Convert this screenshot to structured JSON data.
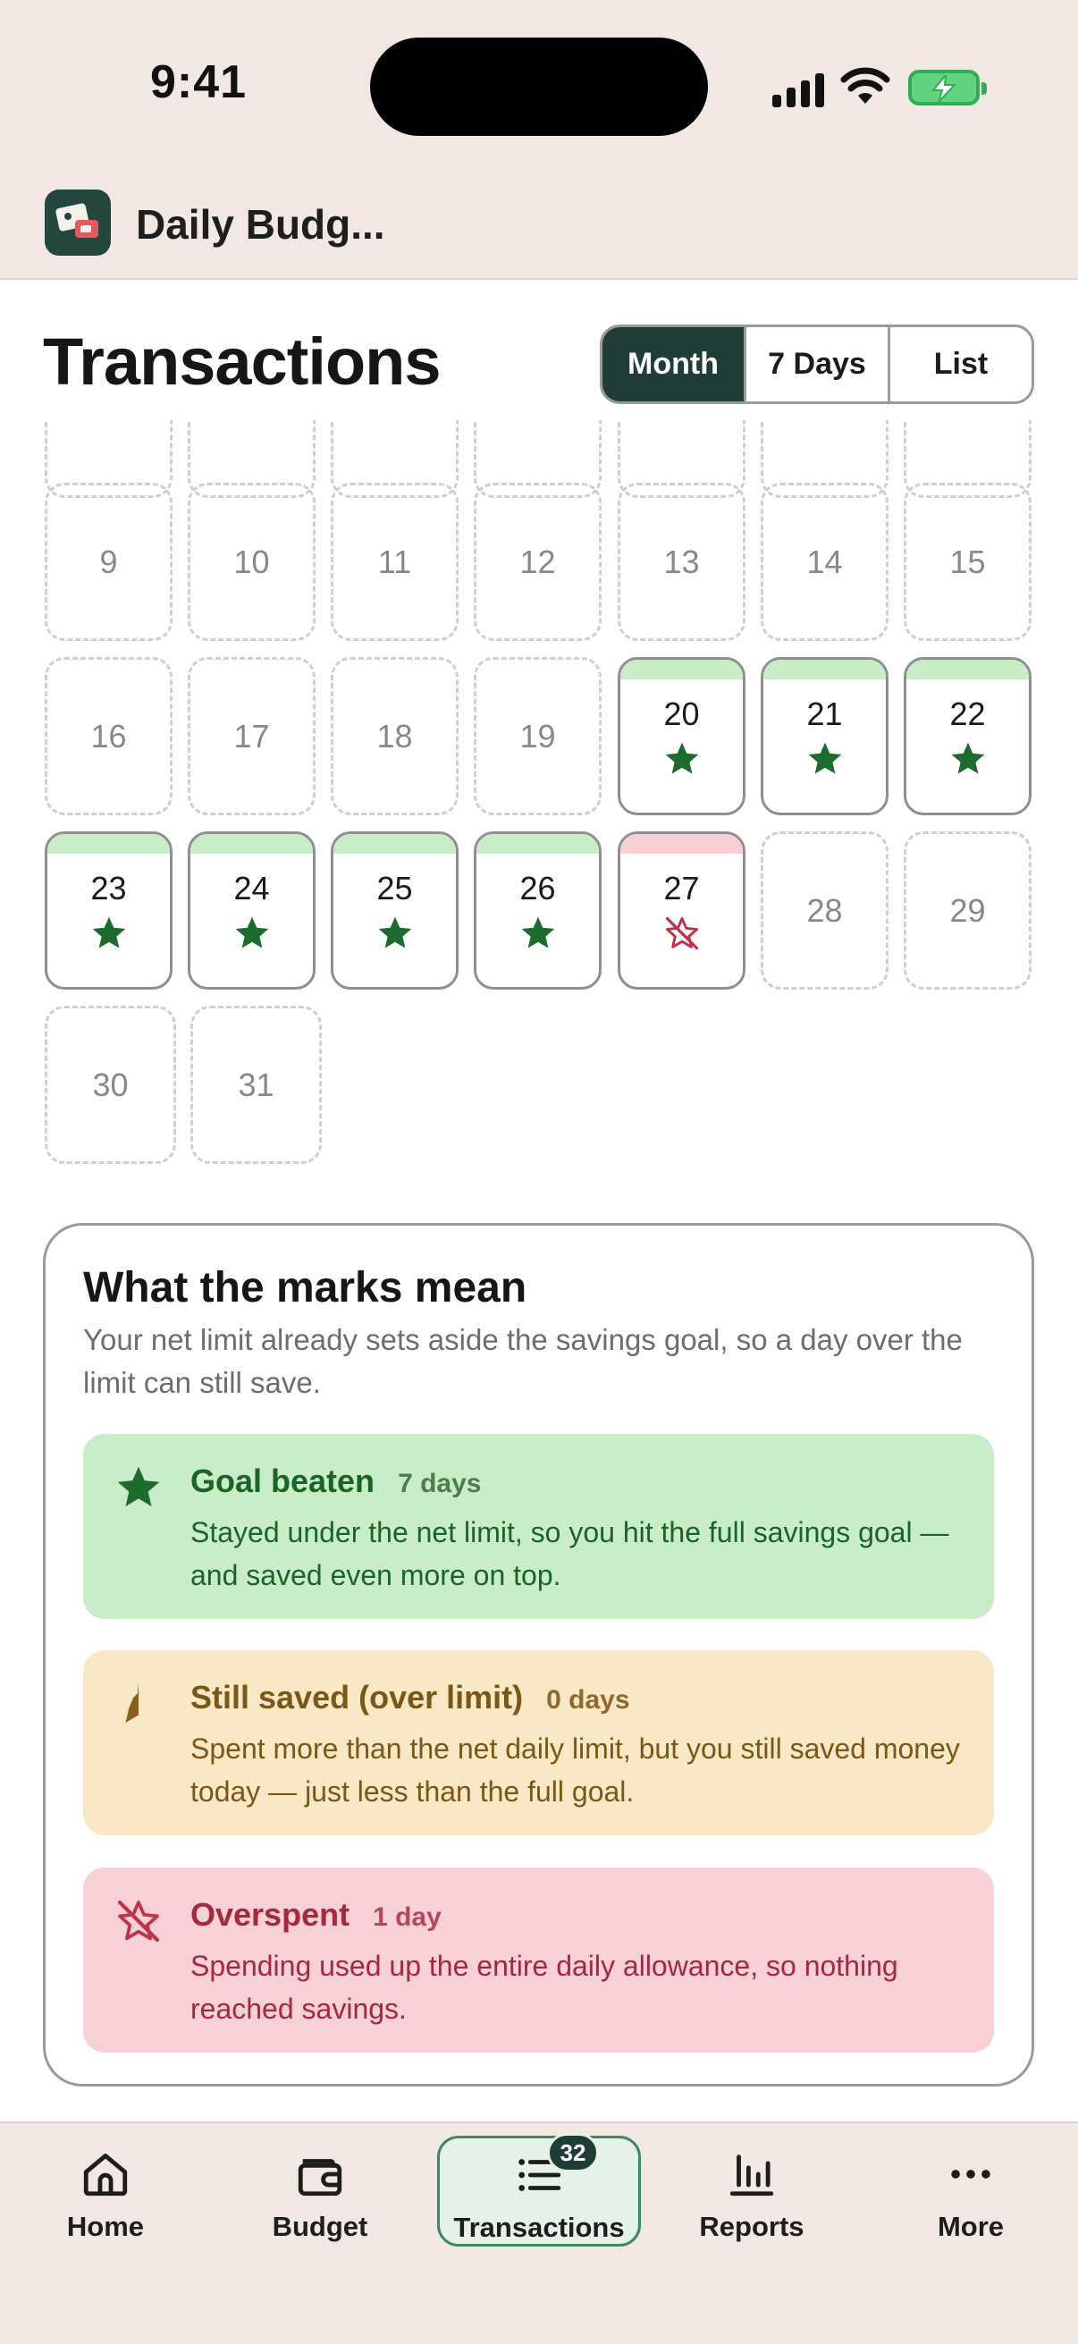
{
  "status_bar": {
    "time": "9:41"
  },
  "app": {
    "title": "Daily Budg..."
  },
  "page": {
    "title": "Transactions",
    "view_tabs": [
      {
        "label": "Month",
        "active": true
      },
      {
        "label": "7 Days",
        "active": false
      },
      {
        "label": "List",
        "active": false
      }
    ]
  },
  "calendar": {
    "colors": {
      "good": "#1e6b2e",
      "bad_strip": "#f8cfd5",
      "good_strip": "#c7ecc6"
    },
    "partial_row_days": 7,
    "days": [
      {
        "day": "9",
        "status": "none"
      },
      {
        "day": "10",
        "status": "none"
      },
      {
        "day": "11",
        "status": "none"
      },
      {
        "day": "12",
        "status": "none"
      },
      {
        "day": "13",
        "status": "none"
      },
      {
        "day": "14",
        "status": "none"
      },
      {
        "day": "15",
        "status": "none"
      },
      {
        "day": "16",
        "status": "none"
      },
      {
        "day": "17",
        "status": "none"
      },
      {
        "day": "18",
        "status": "none"
      },
      {
        "day": "19",
        "status": "none"
      },
      {
        "day": "20",
        "status": "goal"
      },
      {
        "day": "21",
        "status": "goal"
      },
      {
        "day": "22",
        "status": "goal"
      },
      {
        "day": "23",
        "status": "goal"
      },
      {
        "day": "24",
        "status": "goal"
      },
      {
        "day": "25",
        "status": "goal"
      },
      {
        "day": "26",
        "status": "goal"
      },
      {
        "day": "27",
        "status": "overspent"
      },
      {
        "day": "28",
        "status": "none"
      },
      {
        "day": "29",
        "status": "none"
      },
      {
        "day": "30",
        "status": "none"
      },
      {
        "day": "31",
        "status": "none"
      }
    ]
  },
  "legend": {
    "title": "What the marks mean",
    "subtitle": "Your net limit already sets aside the savings goal, so a day over the limit can still save.",
    "items": [
      {
        "key": "goal",
        "icon": "star-filled-icon",
        "name": "Goal beaten",
        "count": "7 days",
        "description": "Stayed under the net limit, so you hit the full savings goal — and saved even more on top.",
        "color": "#1b6427",
        "bg": "#c9edc8"
      },
      {
        "key": "saved",
        "icon": "half-star-icon",
        "name": "Still saved (over limit)",
        "count": "0 days",
        "description": "Spent more than the net daily limit, but you still saved money today — just less than the full goal.",
        "color": "#7a5617",
        "bg": "#f8e8c5"
      },
      {
        "key": "over",
        "icon": "star-slashed-icon",
        "name": "Overspent",
        "count": "1 day",
        "description": "Spending used up the entire daily allowance, so nothing reached savings.",
        "color": "#a5283c",
        "bg": "#f8d1d6"
      }
    ]
  },
  "bottom_nav": {
    "items": [
      {
        "label": "Home",
        "icon": "home-icon"
      },
      {
        "label": "Budget",
        "icon": "wallet-icon"
      },
      {
        "label": "Transactions",
        "icon": "list-icon",
        "badge": "32",
        "selected": true
      },
      {
        "label": "Reports",
        "icon": "bar-chart-icon"
      },
      {
        "label": "More",
        "icon": "more-icon"
      }
    ]
  }
}
